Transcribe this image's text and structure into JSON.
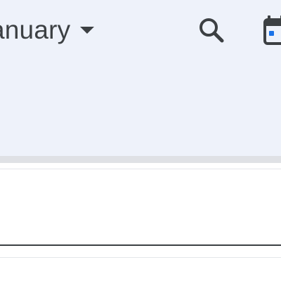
{
  "header": {
    "month_label": "anuary",
    "search_icon": "search-icon",
    "calendar_icon": "calendar-today-icon"
  },
  "colors": {
    "header_bg": "#eef2fa",
    "text": "#3c4043",
    "accent_blue": "#1a73e8",
    "divider": "#dfe1e5"
  }
}
